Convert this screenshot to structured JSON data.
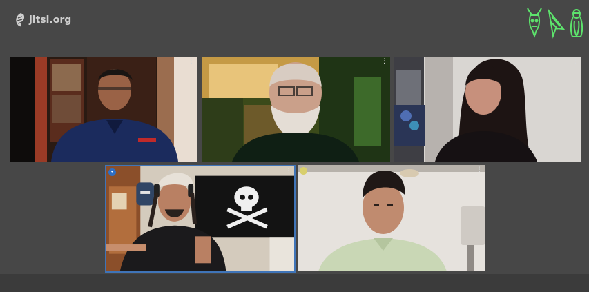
{
  "app": {
    "logo_text": "jitsi.org",
    "accent_color": "#3f74b8",
    "background_color": "#474747"
  },
  "brand_icons": [
    "gnu-head-icon",
    "cursor-arrow-icon",
    "penguin-icon"
  ],
  "participants": [
    {
      "id": "p1",
      "menu": "⋮",
      "badge": null
    },
    {
      "id": "p2",
      "menu": "⋮",
      "badge": null
    },
    {
      "id": "p3",
      "menu": "⋮",
      "badge": null
    },
    {
      "id": "p4",
      "menu": "⋮",
      "badge": {
        "text": "•",
        "color": "#2f6fc4"
      },
      "active_speaker": true
    },
    {
      "id": "p5",
      "menu": "⋮",
      "badge": {
        "text": "",
        "color": "#d8cf6d"
      }
    }
  ]
}
